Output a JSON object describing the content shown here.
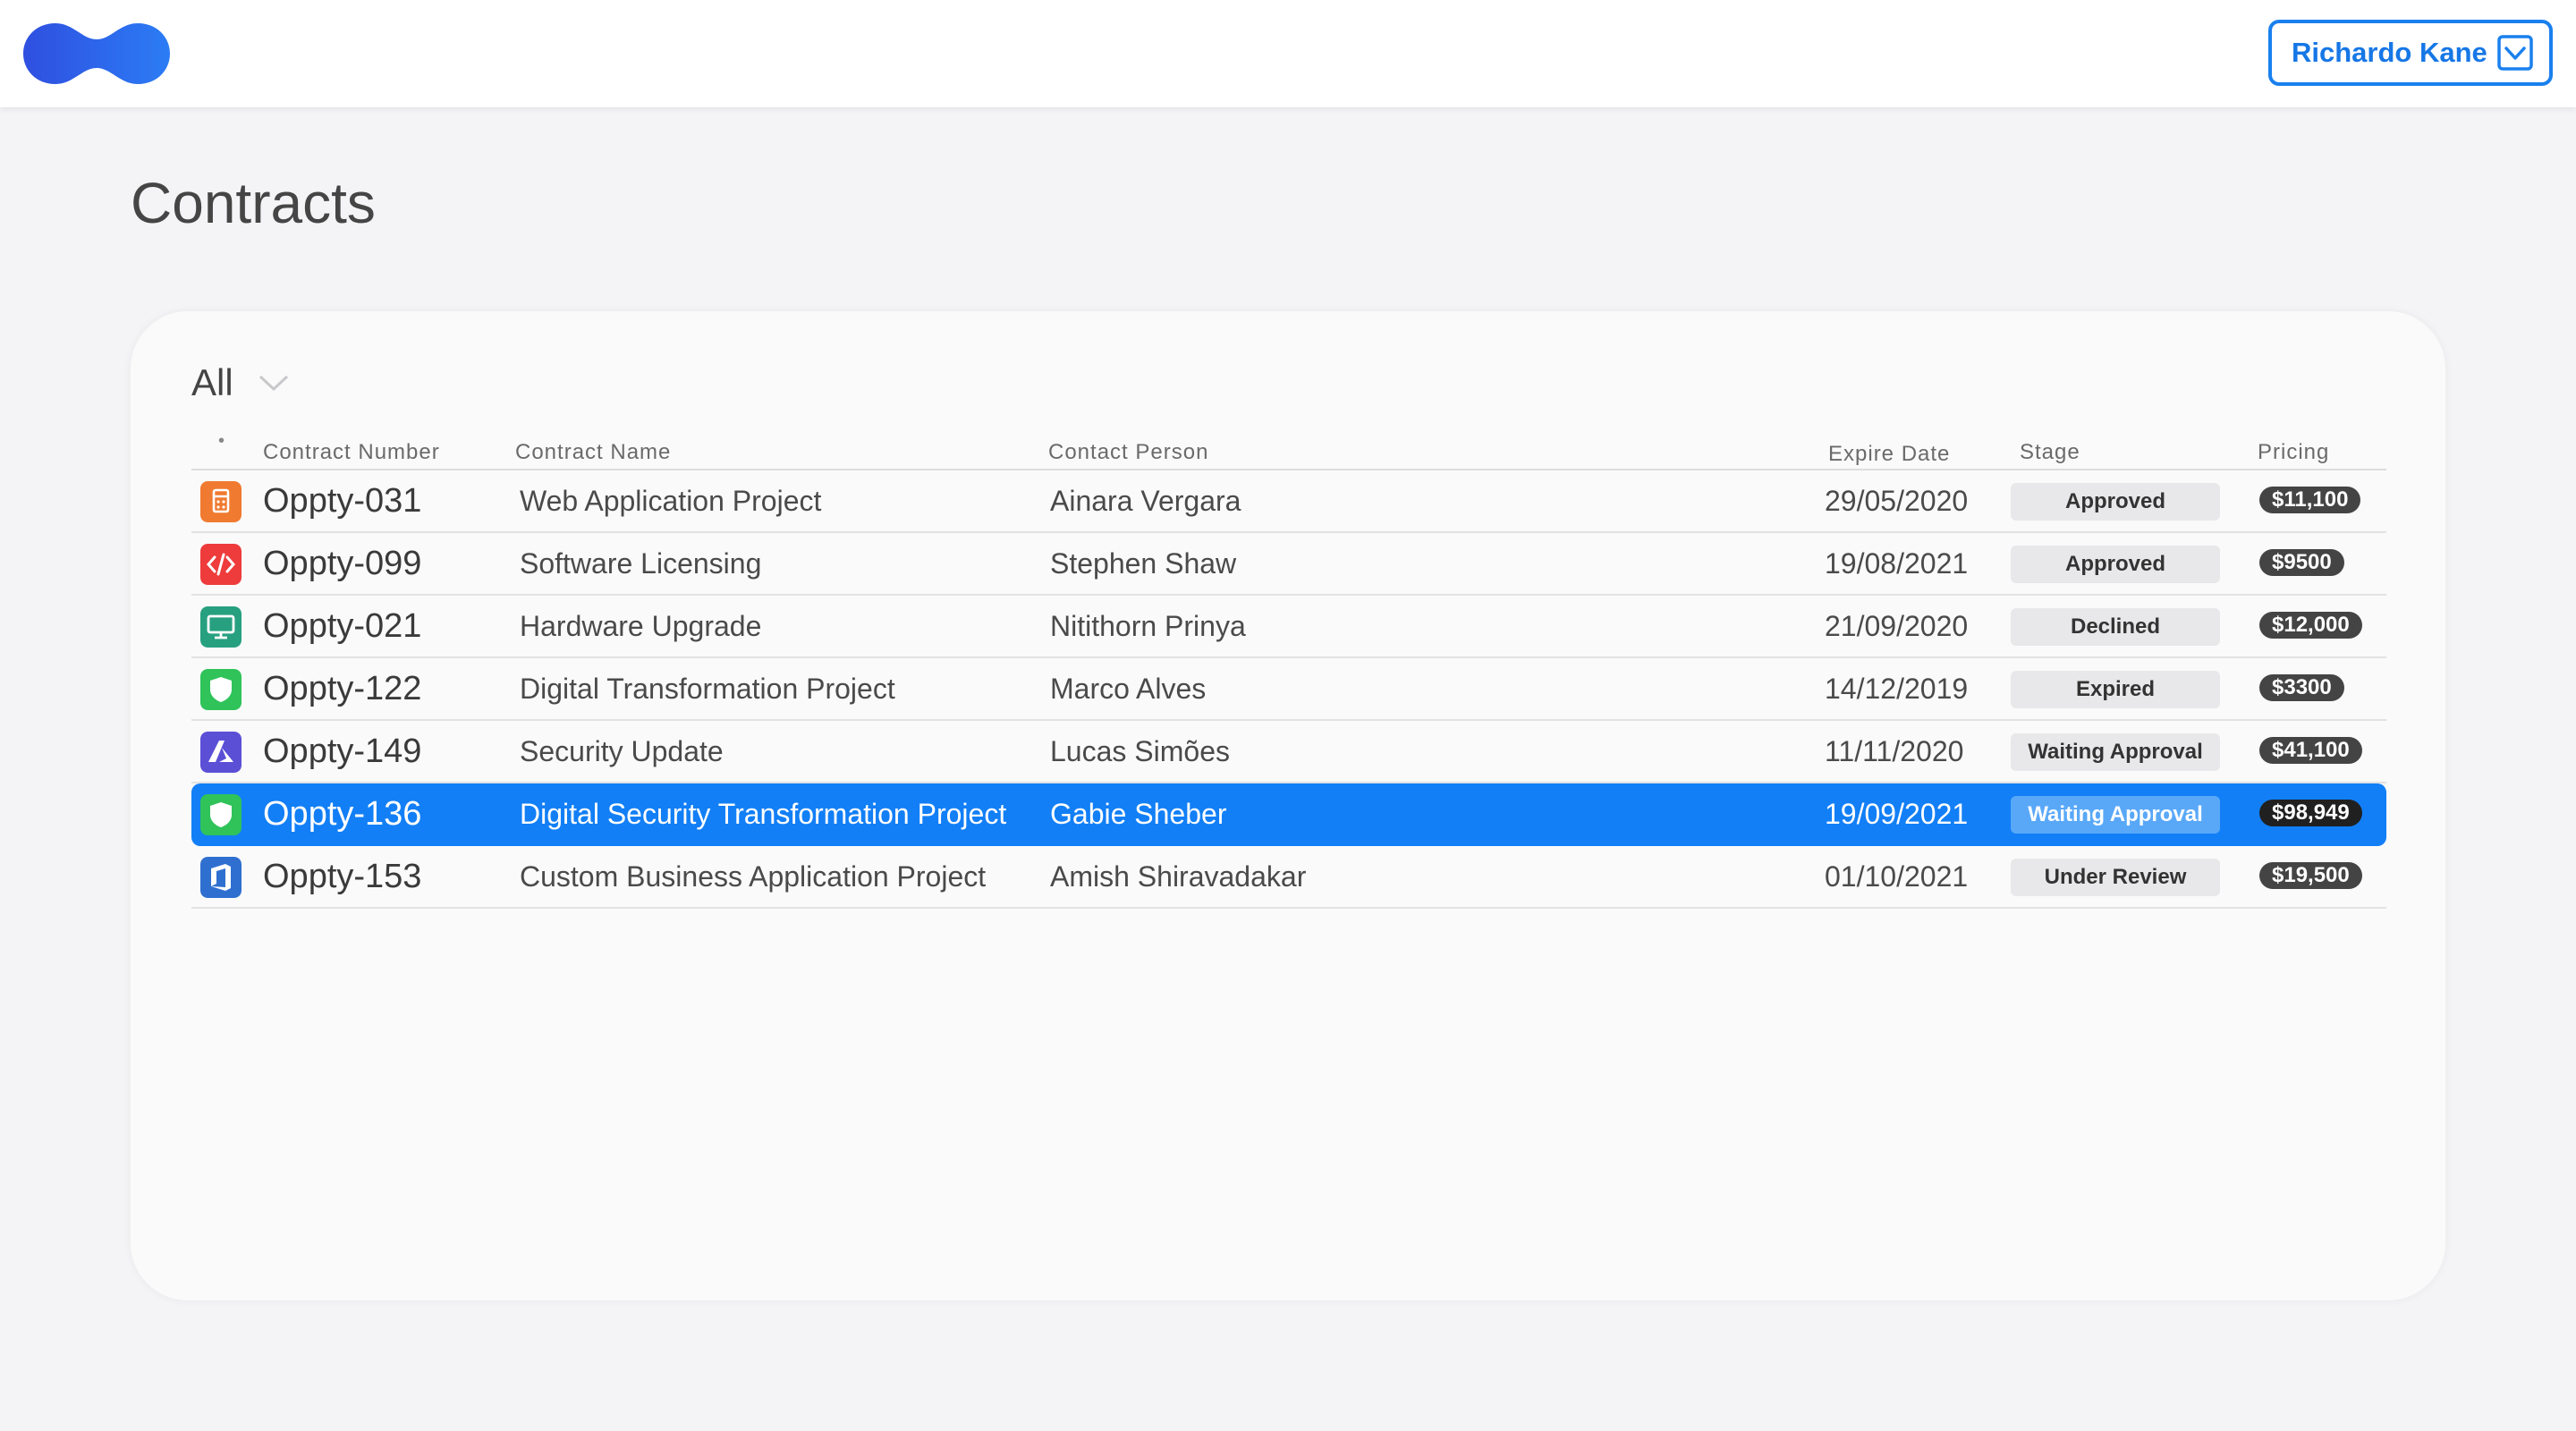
{
  "header": {
    "user_name": "Richardo Kane"
  },
  "page": {
    "title": "Contracts"
  },
  "filter": {
    "label": "All"
  },
  "table": {
    "columns": {
      "dot": "•",
      "number": "Contract Number",
      "name": "Contract Name",
      "contact": "Contact Person",
      "expire": "Expire Date",
      "stage": "Stage",
      "pricing": "Pricing"
    },
    "rows": [
      {
        "icon": "calculator-icon",
        "color": "#f07a30",
        "number": "Oppty-031",
        "name": "Web Application Project",
        "contact": "Ainara Vergara",
        "expire": "29/05/2020",
        "stage": "Approved",
        "pricing": "$11,100"
      },
      {
        "icon": "code-icon",
        "color": "#ee3b3b",
        "number": "Oppty-099",
        "name": "Software Licensing",
        "contact": "Stephen Shaw",
        "expire": "19/08/2021",
        "stage": "Approved",
        "pricing": "$9500"
      },
      {
        "icon": "monitor-icon",
        "color": "#27a080",
        "number": "Oppty-021",
        "name": "Hardware Upgrade",
        "contact": "Nitithorn Prinya",
        "expire": "21/09/2020",
        "stage": "Declined",
        "pricing": "$12,000"
      },
      {
        "icon": "shield-icon",
        "color": "#2fc35a",
        "number": "Oppty-122",
        "name": "Digital Transformation Project",
        "contact": "Marco Alves",
        "expire": "14/12/2019",
        "stage": "Expired",
        "pricing": "$3300"
      },
      {
        "icon": "azure-icon",
        "color": "#5b4fd6",
        "number": "Oppty-149",
        "name": "Security Update",
        "contact": "Lucas Simões",
        "expire": "11/11/2020",
        "stage": "Waiting Approval",
        "pricing": "$41,100"
      },
      {
        "icon": "shield-icon",
        "color": "#2fc35a",
        "number": "Oppty-136",
        "name": "Digital Security Transformation Project",
        "contact": "Gabie Sheber",
        "expire": "19/09/2021",
        "stage": "Waiting Approval",
        "pricing": "$98,949",
        "selected": true
      },
      {
        "icon": "office-icon",
        "color": "#2f6fd0",
        "number": "Oppty-153",
        "name": "Custom Business Application Project",
        "contact": "Amish Shiravadakar",
        "expire": "01/10/2021",
        "stage": "Under Review",
        "pricing": "$19,500"
      }
    ]
  },
  "colors": {
    "accent": "#127ff6",
    "logo_start": "#2f4fe0",
    "logo_end": "#2b7cf5"
  }
}
